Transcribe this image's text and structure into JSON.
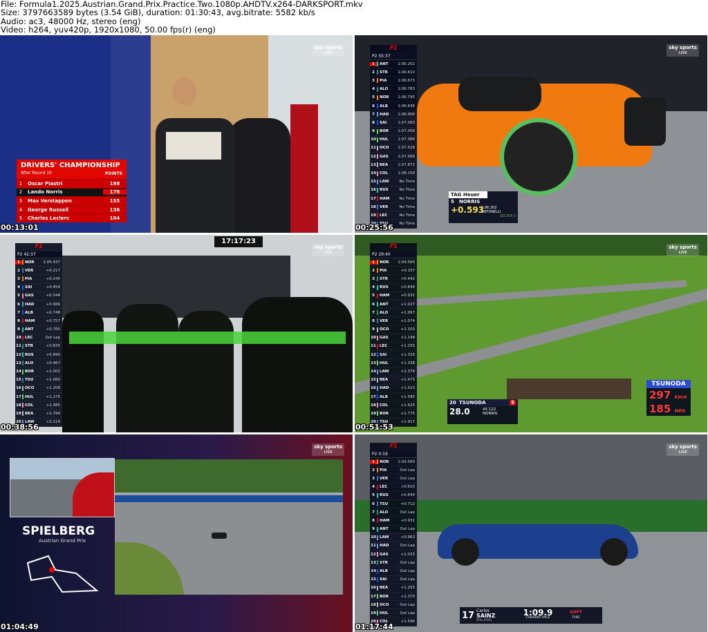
{
  "header": {
    "file_line": "File: Formula1.2025.Austrian.Grand.Prix.Practice.Two.1080p.AHDTV.x264-DARKSPORT.mkv",
    "size_line": "Size: 3797663589 bytes (3.54 GiB), duration: 01:30:43, avg.bitrate: 5582 kb/s",
    "audio_line": "Audio: ac3, 48000 Hz, stereo (eng)",
    "video_line": "Video: h264, yuv420p, 1920x1080, 50.00 fps(r) (eng)"
  },
  "broadcaster": {
    "name": "sky sports",
    "tag": "LIVE"
  },
  "thumbnails": [
    {
      "timestamp": "00:13:01"
    },
    {
      "timestamp": "00:25:56"
    },
    {
      "timestamp": "00:38:56"
    },
    {
      "timestamp": "00:51:53"
    },
    {
      "timestamp": "01:04:49"
    },
    {
      "timestamp": "01:17:44"
    }
  ],
  "championship": {
    "title": "DRIVERS' CHAMPIONSHIP",
    "subtitle": "After Round 10",
    "points_label": "POINTS",
    "rows": [
      {
        "pos": "1",
        "name": "Oscar Piastri",
        "pts": "198"
      },
      {
        "pos": "2",
        "name": "Lando Norris",
        "pts": "176"
      },
      {
        "pos": "3",
        "name": "Max Verstappen",
        "pts": "155"
      },
      {
        "pos": "4",
        "name": "George Russell",
        "pts": "136"
      },
      {
        "pos": "5",
        "name": "Charles Leclerc",
        "pts": "104"
      }
    ]
  },
  "tower1": {
    "session": "P2 55:37",
    "rows": [
      {
        "p": "1",
        "c": "ANT",
        "g": "1:06.202",
        "col": "#00d2be"
      },
      {
        "p": "2",
        "c": "STR",
        "g": "1:06.610",
        "col": "#229971"
      },
      {
        "p": "3",
        "c": "PIA",
        "g": "1:06.673",
        "col": "#ff8000"
      },
      {
        "p": "4",
        "c": "ALO",
        "g": "1:06.783",
        "col": "#229971"
      },
      {
        "p": "5",
        "c": "NOR",
        "g": "1:06.795",
        "col": "#ff8000"
      },
      {
        "p": "6",
        "c": "ALB",
        "g": "1:06.836",
        "col": "#005aff"
      },
      {
        "p": "7",
        "c": "HAD",
        "g": "1:06.956",
        "col": "#6692ff"
      },
      {
        "p": "8",
        "c": "SAI",
        "g": "1:07.050",
        "col": "#005aff"
      },
      {
        "p": "9",
        "c": "BOR",
        "g": "1:07.056",
        "col": "#52e252"
      },
      {
        "p": "10",
        "c": "HUL",
        "g": "1:07.386",
        "col": "#52e252"
      },
      {
        "p": "11",
        "c": "OCO",
        "g": "1:07.528",
        "col": "#b6babd"
      },
      {
        "p": "12",
        "c": "GAS",
        "g": "1:07.566",
        "col": "#ff87bc"
      },
      {
        "p": "13",
        "c": "BEA",
        "g": "1:07.871",
        "col": "#b6babd"
      },
      {
        "p": "14",
        "c": "COL",
        "g": "1:08.159",
        "col": "#ff87bc"
      },
      {
        "p": "15",
        "c": "LAW",
        "g": "No Time",
        "col": "#6692ff"
      },
      {
        "p": "16",
        "c": "RUS",
        "g": "No Time",
        "col": "#00d2be"
      },
      {
        "p": "17",
        "c": "HAM",
        "g": "No Time",
        "col": "#e8002d"
      },
      {
        "p": "18",
        "c": "VER",
        "g": "No Time",
        "col": "#3671c6"
      },
      {
        "p": "19",
        "c": "LEC",
        "g": "No Time",
        "col": "#e8002d"
      },
      {
        "p": "20",
        "c": "TSU",
        "g": "No Time",
        "col": "#3671c6"
      }
    ]
  },
  "lowerthird2": {
    "sponsor": "TAG Heuer",
    "pos": "5",
    "driver": "NORRIS",
    "laptime": "1:06.202",
    "ref": "ANTONELLI",
    "delta": "+0.593",
    "sector": "SECTOR 3"
  },
  "tower3": {
    "session": "P2 42:37",
    "clock": "17:17:23",
    "rows": [
      {
        "p": "1",
        "c": "NOR",
        "g": "1:05.437",
        "col": "#ff8000"
      },
      {
        "p": "2",
        "c": "VER",
        "g": "+0.217",
        "col": "#3671c6"
      },
      {
        "p": "3",
        "c": "PIA",
        "g": "+0.245",
        "col": "#ff8000"
      },
      {
        "p": "4",
        "c": "SAI",
        "g": "+0.454",
        "col": "#005aff"
      },
      {
        "p": "5",
        "c": "GAS",
        "g": "+0.544",
        "col": "#ff87bc"
      },
      {
        "p": "6",
        "c": "HAD",
        "g": "+0.666",
        "col": "#6692ff"
      },
      {
        "p": "7",
        "c": "ALB",
        "g": "+0.748",
        "col": "#005aff"
      },
      {
        "p": "8",
        "c": "HAM",
        "g": "+0.757",
        "col": "#e8002d"
      },
      {
        "p": "9",
        "c": "ANT",
        "g": "+0.765",
        "col": "#00d2be"
      },
      {
        "p": "10",
        "c": "LEC",
        "g": "Out Lap",
        "col": "#e8002d"
      },
      {
        "p": "11",
        "c": "STR",
        "g": "+0.835",
        "col": "#229971"
      },
      {
        "p": "12",
        "c": "RUS",
        "g": "+0.890",
        "col": "#00d2be"
      },
      {
        "p": "13",
        "c": "ALO",
        "g": "+0.967",
        "col": "#229971"
      },
      {
        "p": "14",
        "c": "BOR",
        "g": "+1.002",
        "col": "#52e252"
      },
      {
        "p": "15",
        "c": "TSU",
        "g": "+1.060",
        "col": "#3671c6"
      },
      {
        "p": "16",
        "c": "OCO",
        "g": "+1.208",
        "col": "#b6babd"
      },
      {
        "p": "17",
        "c": "HUL",
        "g": "+1.275",
        "col": "#52e252"
      },
      {
        "p": "18",
        "c": "COL",
        "g": "+1.485",
        "col": "#ff87bc"
      },
      {
        "p": "19",
        "c": "BEA",
        "g": "+1.794",
        "col": "#b6babd"
      },
      {
        "p": "20",
        "c": "LAW",
        "g": "+2.114",
        "col": "#6692ff"
      }
    ]
  },
  "tower4": {
    "session": "P2 29:40",
    "rows": [
      {
        "p": "1",
        "c": "NOR",
        "g": "1:04.580",
        "col": "#ff8000"
      },
      {
        "p": "2",
        "c": "PIA",
        "g": "+0.157",
        "col": "#ff8000"
      },
      {
        "p": "3",
        "c": "STR",
        "g": "+0.442",
        "col": "#229971"
      },
      {
        "p": "4",
        "c": "RUS",
        "g": "+0.649",
        "col": "#00d2be"
      },
      {
        "p": "5",
        "c": "HAM",
        "g": "+0.931",
        "col": "#e8002d"
      },
      {
        "p": "6",
        "c": "ANT",
        "g": "+1.027",
        "col": "#00d2be"
      },
      {
        "p": "7",
        "c": "ALO",
        "g": "+1.067",
        "col": "#229971"
      },
      {
        "p": "8",
        "c": "VER",
        "g": "+1.074",
        "col": "#3671c6"
      },
      {
        "p": "9",
        "c": "OCO",
        "g": "+1.103",
        "col": "#b6babd"
      },
      {
        "p": "10",
        "c": "GAS",
        "g": "+1.148",
        "col": "#ff87bc"
      },
      {
        "p": "11",
        "c": "LEC",
        "g": "+1.255",
        "col": "#e8002d"
      },
      {
        "p": "12",
        "c": "SAI",
        "g": "+1.316",
        "col": "#005aff"
      },
      {
        "p": "13",
        "c": "HUL",
        "g": "+1.338",
        "col": "#52e252"
      },
      {
        "p": "14",
        "c": "LAW",
        "g": "+1.374",
        "col": "#6692ff"
      },
      {
        "p": "15",
        "c": "BEA",
        "g": "+1.473",
        "col": "#b6babd"
      },
      {
        "p": "16",
        "c": "HAD",
        "g": "+1.523",
        "col": "#6692ff"
      },
      {
        "p": "17",
        "c": "ALB",
        "g": "+1.585",
        "col": "#005aff"
      },
      {
        "p": "18",
        "c": "COL",
        "g": "+1.625",
        "col": "#ff87bc"
      },
      {
        "p": "19",
        "c": "BOR",
        "g": "+1.775",
        "col": "#52e252"
      },
      {
        "p": "20",
        "c": "TSU",
        "g": "+1.917",
        "col": "#3671c6"
      }
    ]
  },
  "lowerthird4": {
    "pos": "20",
    "driver": "TSUNODA",
    "num": "5",
    "time": "28.0",
    "ref_time": "45.122",
    "ref": "NORRIS",
    "speed_name": "TSUNODA",
    "kmh": "297",
    "kmh_unit": "KM/H",
    "mph": "185",
    "mph_unit": "MPH"
  },
  "circuit": {
    "name": "SPIELBERG",
    "event": "Austrian Grand Prix"
  },
  "tower6": {
    "session": "P2 0:19",
    "rows": [
      {
        "p": "1",
        "c": "NOR",
        "g": "1:04.580",
        "col": "#ff8000"
      },
      {
        "p": "2",
        "c": "PIA",
        "g": "Out Lap",
        "col": "#ff8000"
      },
      {
        "p": "3",
        "c": "VER",
        "g": "Out Lap",
        "col": "#3671c6"
      },
      {
        "p": "4",
        "c": "LEC",
        "g": "+0.610",
        "col": "#e8002d"
      },
      {
        "p": "5",
        "c": "RUS",
        "g": "+0.649",
        "col": "#00d2be"
      },
      {
        "p": "6",
        "c": "TSU",
        "g": "+0.712",
        "col": "#3671c6"
      },
      {
        "p": "7",
        "c": "ALO",
        "g": "Out Lap",
        "col": "#229971"
      },
      {
        "p": "8",
        "c": "HAM",
        "g": "+0.931",
        "col": "#e8002d"
      },
      {
        "p": "9",
        "c": "ANT",
        "g": "Out Lap",
        "col": "#00d2be"
      },
      {
        "p": "10",
        "c": "LAW",
        "g": "+0.963",
        "col": "#6692ff"
      },
      {
        "p": "11",
        "c": "HAD",
        "g": "Out Lap",
        "col": "#6692ff"
      },
      {
        "p": "12",
        "c": "GAS",
        "g": "+1.033",
        "col": "#ff87bc"
      },
      {
        "p": "13",
        "c": "STR",
        "g": "Out Lap",
        "col": "#229971"
      },
      {
        "p": "14",
        "c": "ALB",
        "g": "Out Lap",
        "col": "#005aff"
      },
      {
        "p": "15",
        "c": "SAI",
        "g": "Out Lap",
        "col": "#005aff"
      },
      {
        "p": "16",
        "c": "BEA",
        "g": "+1.255",
        "col": "#b6babd"
      },
      {
        "p": "17",
        "c": "BOR",
        "g": "+1.370",
        "col": "#52e252"
      },
      {
        "p": "18",
        "c": "OCO",
        "g": "Out Lap",
        "col": "#b6babd"
      },
      {
        "p": "19",
        "c": "HUL",
        "g": "Out Lap",
        "col": "#52e252"
      },
      {
        "p": "20",
        "c": "COL",
        "g": "+1.596",
        "col": "#ff87bc"
      }
    ]
  },
  "lowerthird6": {
    "num": "17",
    "first": "Carlos",
    "last": "SAINZ",
    "team": "WILLIAMS",
    "pace": "1:09.9",
    "pace_label": "CURRENT PACE",
    "tyre": "SOFT",
    "tyre_label": "TYRE"
  }
}
